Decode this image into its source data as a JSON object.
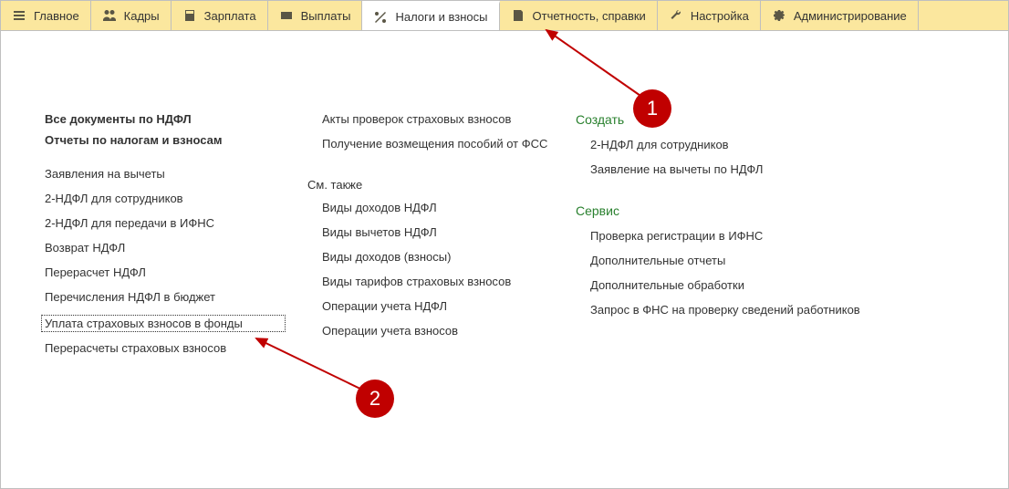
{
  "topTabs": [
    {
      "label": "Главное",
      "icon": "menu",
      "name": "tab-main"
    },
    {
      "label": "Кадры",
      "icon": "people",
      "name": "tab-hr"
    },
    {
      "label": "Зарплата",
      "icon": "calc",
      "name": "tab-salary"
    },
    {
      "label": "Выплаты",
      "icon": "card",
      "name": "tab-payments"
    },
    {
      "label": "Налоги и взносы",
      "icon": "percent",
      "name": "tab-taxes",
      "active": true
    },
    {
      "label": "Отчетность, справки",
      "icon": "doc",
      "name": "tab-reports"
    },
    {
      "label": "Настройка",
      "icon": "wrench",
      "name": "tab-settings"
    },
    {
      "label": "Администрирование",
      "icon": "gear",
      "name": "tab-admin"
    }
  ],
  "col1": {
    "h1a": "Все документы по НДФЛ",
    "h1b": "Отчеты по налогам и взносам",
    "links": [
      "Заявления на вычеты",
      "2-НДФЛ для сотрудников",
      "2-НДФЛ для передачи в ИФНС",
      "Возврат НДФЛ",
      "Перерасчет НДФЛ",
      "Перечисления НДФЛ в бюджет",
      "Уплата страховых взносов в фонды",
      "Перерасчеты страховых взносов"
    ],
    "selectedIndex": 6
  },
  "col2": {
    "top": [
      "Акты проверок страховых взносов",
      "Получение возмещения пособий от ФСС"
    ],
    "seeAlsoTitle": "См. также",
    "seeAlso": [
      "Виды доходов НДФЛ",
      "Виды вычетов НДФЛ",
      "Виды доходов (взносы)",
      "Виды тарифов страховых взносов",
      "Операции учета НДФЛ",
      "Операции учета взносов"
    ]
  },
  "col3": {
    "createTitle": "Создать",
    "createLinks": [
      "2-НДФЛ для сотрудников",
      "Заявление на вычеты по НДФЛ"
    ],
    "serviceTitle": "Сервис",
    "serviceLinks": [
      "Проверка регистрации в ИФНС",
      "Дополнительные отчеты",
      "Дополнительные обработки",
      "Запрос в ФНС на проверку сведений работников"
    ]
  },
  "callouts": {
    "one": "1",
    "two": "2"
  }
}
